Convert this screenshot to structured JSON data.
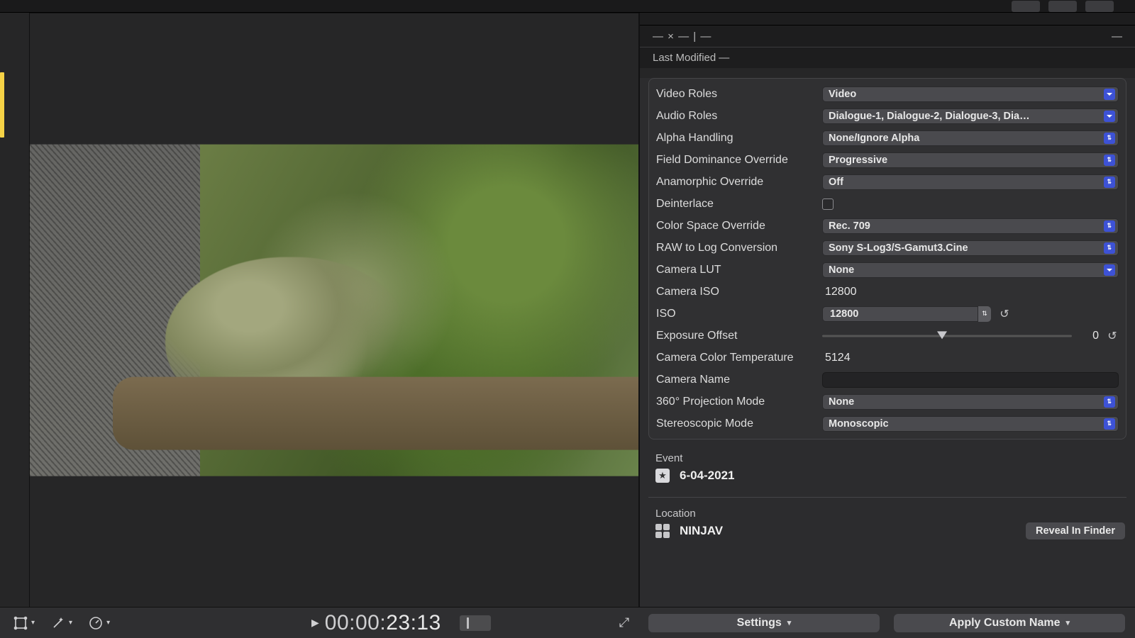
{
  "header": {
    "dash_text": "— × — | —",
    "collapse_glyph": "—",
    "last_modified_label": "Last Modified",
    "last_modified_value": "—"
  },
  "props": {
    "video_roles": {
      "label": "Video Roles",
      "value": "Video"
    },
    "audio_roles": {
      "label": "Audio Roles",
      "value": "Dialogue-1, Dialogue-2, Dialogue-3, Dia…"
    },
    "alpha": {
      "label": "Alpha Handling",
      "value": "None/Ignore Alpha"
    },
    "field_dom": {
      "label": "Field Dominance Override",
      "value": "Progressive"
    },
    "anamorphic": {
      "label": "Anamorphic Override",
      "value": "Off"
    },
    "deinterlace": {
      "label": "Deinterlace"
    },
    "cs_override": {
      "label": "Color Space Override",
      "value": "Rec. 709"
    },
    "raw_log": {
      "label": "RAW to Log Conversion",
      "value": "Sony S-Log3/S-Gamut3.Cine"
    },
    "cam_lut": {
      "label": "Camera LUT",
      "value": "None"
    },
    "cam_iso": {
      "label": "Camera ISO",
      "value": "12800"
    },
    "iso": {
      "label": "ISO",
      "value": "12800"
    },
    "exp_offset": {
      "label": "Exposure Offset",
      "value": "0"
    },
    "cam_ctemp": {
      "label": "Camera Color Temperature",
      "value": "5124"
    },
    "cam_name": {
      "label": "Camera Name",
      "value": ""
    },
    "proj_mode": {
      "label": "360° Projection Mode",
      "value": "None"
    },
    "stereo": {
      "label": "Stereoscopic Mode",
      "value": "Monoscopic"
    }
  },
  "event": {
    "section_label": "Event",
    "name": "6-04-2021"
  },
  "location": {
    "section_label": "Location",
    "name": "NINJAV",
    "reveal_label": "Reveal In Finder"
  },
  "transport": {
    "timecode_dim": "00:00:",
    "timecode_bright": "23:13"
  },
  "footer": {
    "settings_label": "Settings",
    "apply_name_label": "Apply Custom Name"
  }
}
